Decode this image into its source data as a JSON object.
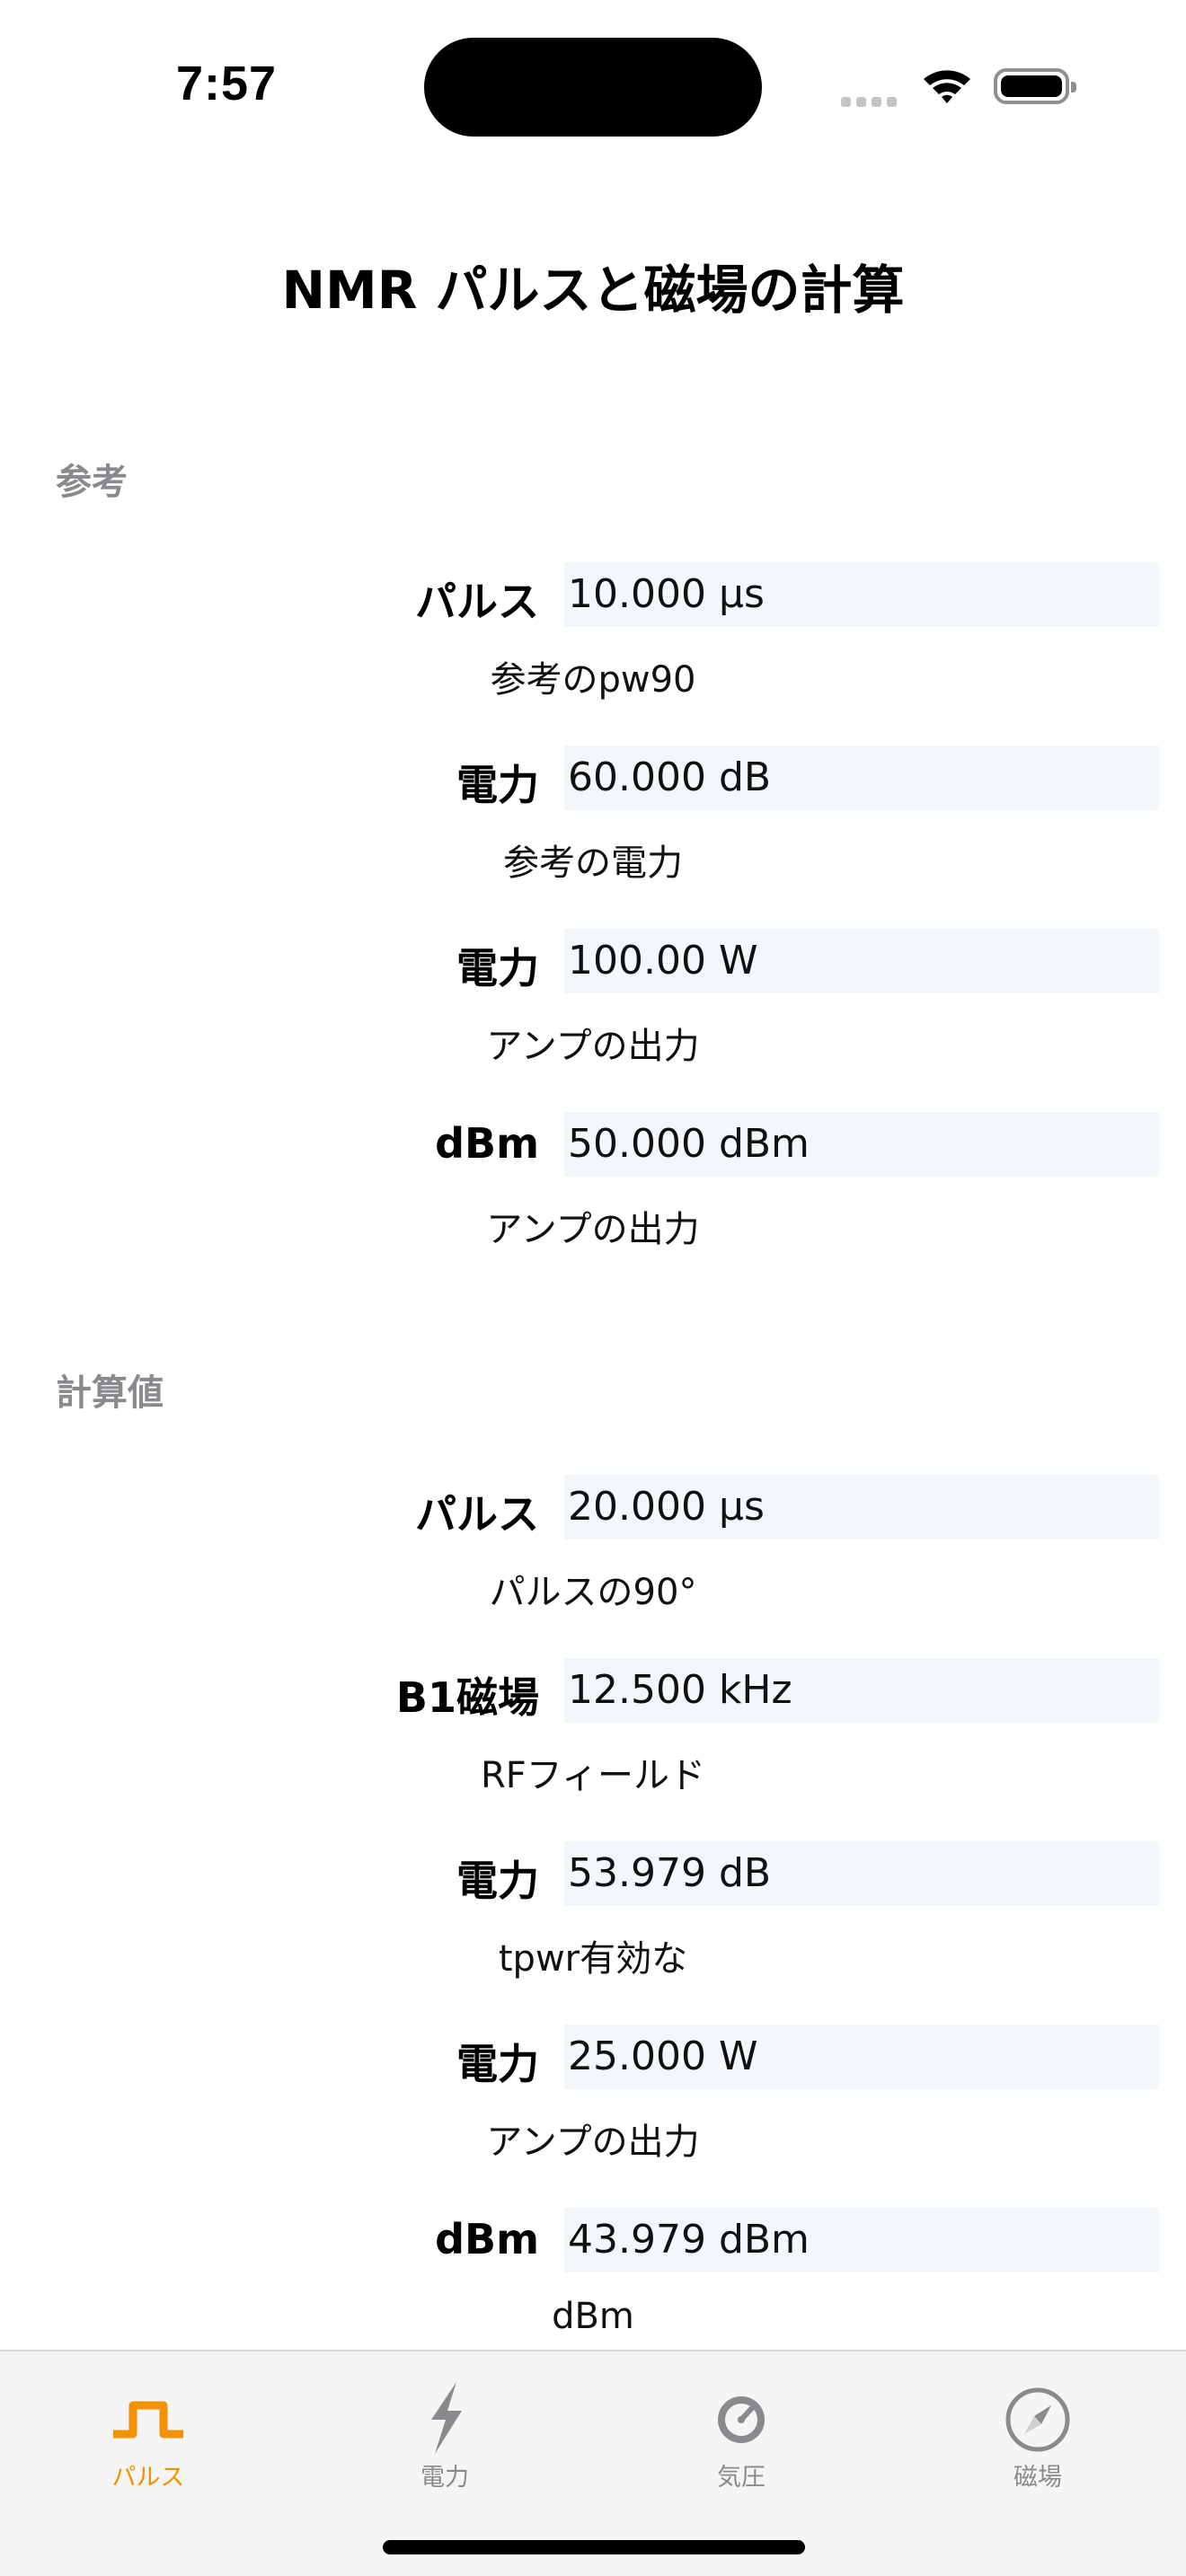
{
  "status_bar": {
    "time": "7:57"
  },
  "title": "NMR パルスと磁場の計算",
  "sections": [
    {
      "header": "参考",
      "rows": [
        {
          "label": "パルス",
          "value": "10.000 μs",
          "caption": "参考のpw90"
        },
        {
          "label": "電力",
          "value": "60.000 dB",
          "caption": "参考の電力"
        },
        {
          "label": "電力",
          "value": "100.00 W",
          "caption": "アンプの出力"
        },
        {
          "label": "dBm",
          "value": "50.000 dBm",
          "caption": "アンプの出力"
        }
      ]
    },
    {
      "header": "計算値",
      "rows": [
        {
          "label": "パルス",
          "value": "20.000 μs",
          "caption": "パルスの90°"
        },
        {
          "label": "B1磁場",
          "value": "12.500 kHz",
          "caption": "RFフィールド"
        },
        {
          "label": "電力",
          "value": "53.979 dB",
          "caption": "tpwr有効な"
        },
        {
          "label": "電力",
          "value": "25.000 W",
          "caption": "アンプの出力"
        },
        {
          "label": "dBm",
          "value": "43.979 dBm",
          "caption": "dBm"
        }
      ]
    }
  ],
  "tabs": [
    {
      "label": "パルス",
      "icon": "pulse-icon",
      "active": true
    },
    {
      "label": "電力",
      "icon": "bolt-icon",
      "active": false
    },
    {
      "label": "気圧",
      "icon": "gauge-icon",
      "active": false
    },
    {
      "label": "磁場",
      "icon": "compass-icon",
      "active": false
    }
  ],
  "colors": {
    "accent": "#f39200",
    "inactive": "#8a8a8e",
    "field_bg": "#f3f7fa"
  }
}
